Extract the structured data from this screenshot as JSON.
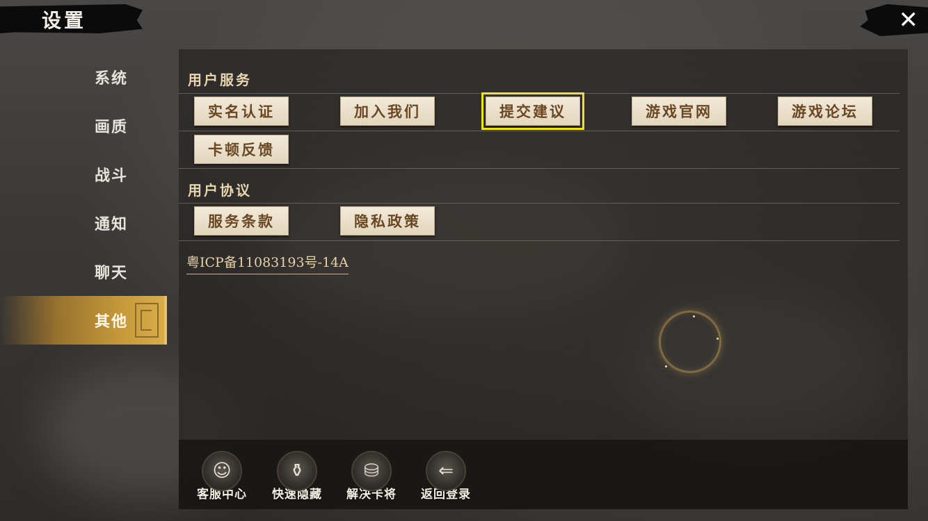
{
  "header": {
    "title": "设置",
    "close_icon": "close-icon"
  },
  "sidebar": {
    "items": [
      {
        "label": "系统"
      },
      {
        "label": "画质"
      },
      {
        "label": "战斗"
      },
      {
        "label": "通知"
      },
      {
        "label": "聊天"
      },
      {
        "label": "其他",
        "active": true
      }
    ]
  },
  "main": {
    "user_service": {
      "title": "用户服务",
      "buttons": [
        "实名认证",
        "加入我们",
        "提交建议",
        "游戏官网",
        "游戏论坛",
        "卡顿反馈"
      ],
      "focused": "提交建议"
    },
    "user_agreement": {
      "title": "用户协议",
      "buttons": [
        "服务条款",
        "隐私政策"
      ]
    },
    "icp": "粤ICP备11083193号-14A"
  },
  "bottombar": {
    "tools": [
      {
        "label": "客服中心",
        "icon": "customer-service-icon"
      },
      {
        "label": "快速隐藏",
        "icon": "quick-hide-icon"
      },
      {
        "label": "解决卡将",
        "icon": "fix-stuck-icon"
      },
      {
        "label": "返回登录",
        "icon": "return-login-icon"
      }
    ]
  },
  "colors": {
    "accent_gold": "#c79a3a",
    "focus_outline": "#f1e21a",
    "button_text": "#6a4724"
  }
}
